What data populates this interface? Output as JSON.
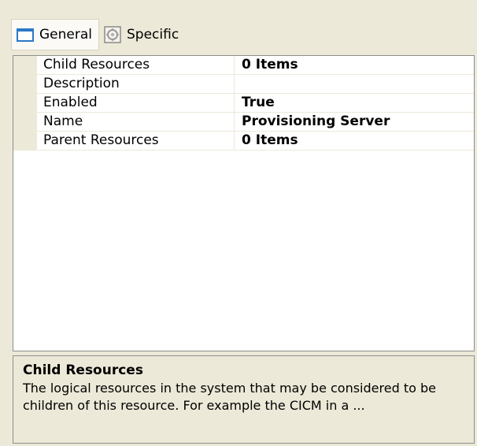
{
  "toolbar": {
    "tabs": [
      {
        "label": "General",
        "icon": "general-icon",
        "active": true
      },
      {
        "label": "Specific",
        "icon": "specific-icon",
        "active": false
      }
    ]
  },
  "grid": {
    "rows": [
      {
        "name": "Child Resources",
        "value": "0 Items"
      },
      {
        "name": "Description",
        "value": ""
      },
      {
        "name": "Enabled",
        "value": "True"
      },
      {
        "name": "Name",
        "value": "Provisioning Server"
      },
      {
        "name": "Parent Resources",
        "value": "0 Items"
      }
    ]
  },
  "help": {
    "title": "Child Resources",
    "description": "The logical resources in the system that may be considered to be children of this resource. For example the CICM in a ..."
  },
  "colors": {
    "background": "#ece9d8",
    "grid_background": "#ffffff",
    "border": "#8e8e8e",
    "icon_accent": "#2c78c8"
  }
}
